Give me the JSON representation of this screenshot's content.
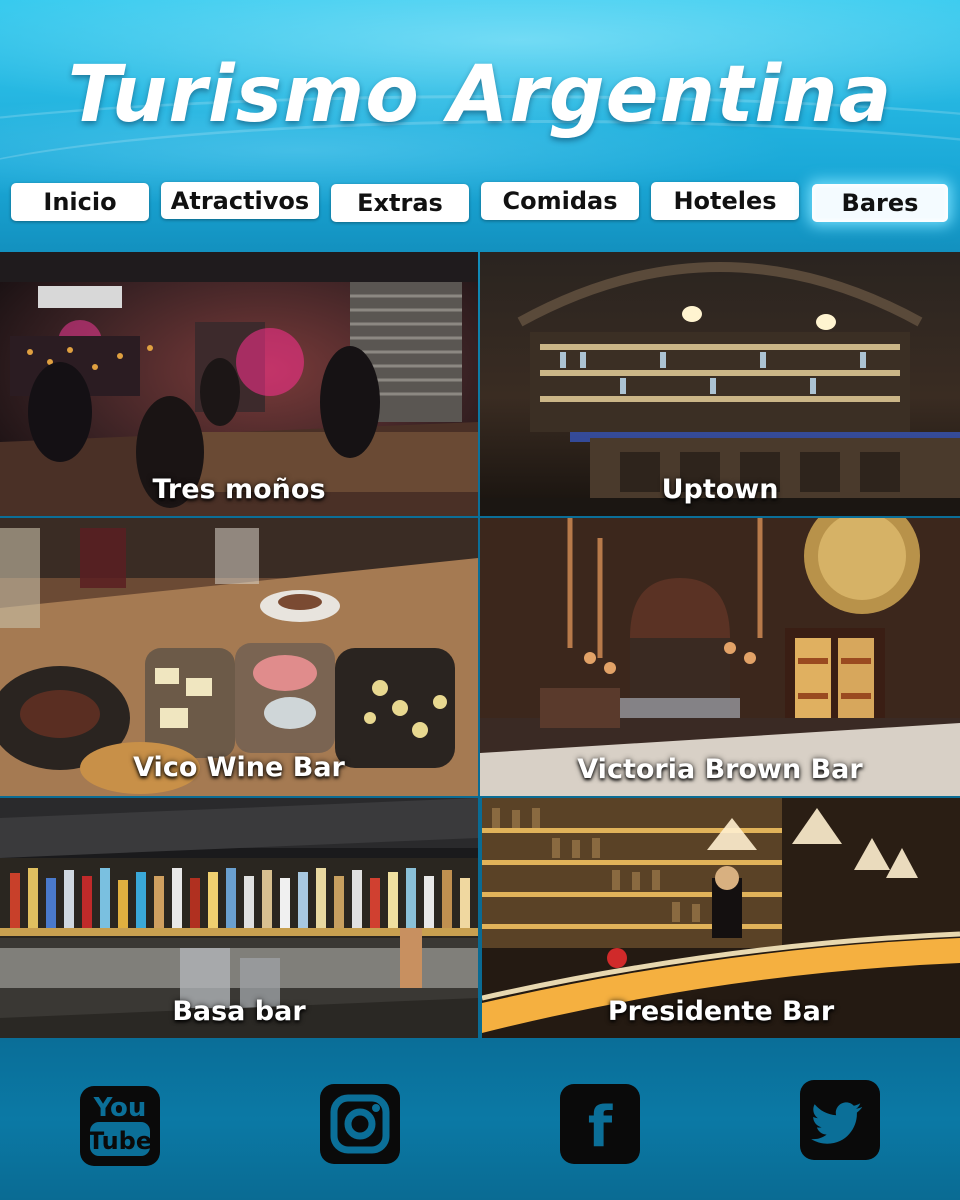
{
  "site": {
    "title": "Turismo Argentina"
  },
  "nav": {
    "items": [
      {
        "label": "Inicio"
      },
      {
        "label": "Atractivos"
      },
      {
        "label": "Extras"
      },
      {
        "label": "Comidas"
      },
      {
        "label": "Hoteles"
      },
      {
        "label": "Bares",
        "active": true
      }
    ]
  },
  "bars": [
    {
      "name": "Tres moños"
    },
    {
      "name": "Uptown"
    },
    {
      "name": "Vico Wine Bar"
    },
    {
      "name": "Victoria Brown Bar"
    },
    {
      "name": "Basa bar"
    },
    {
      "name": "Presidente Bar"
    }
  ],
  "social": {
    "youtube": {
      "icon": "youtube-icon",
      "line1": "You",
      "line2": "Tube"
    },
    "instagram": {
      "icon": "instagram-icon"
    },
    "facebook": {
      "icon": "facebook-icon",
      "glyph": "f"
    },
    "twitter": {
      "icon": "twitter-icon"
    }
  },
  "colors": {
    "header_top": "#34c9ee",
    "background": "#0b6f98",
    "nav_button": "#ffffff",
    "active_glow": "#78e1ff",
    "social_icon_bg": "#0a0a0a"
  }
}
